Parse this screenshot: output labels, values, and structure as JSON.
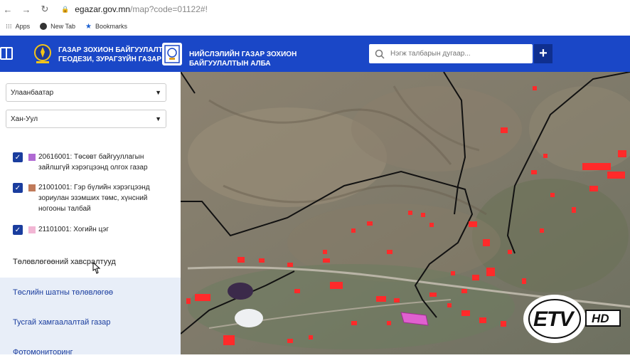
{
  "browser": {
    "back_icon": "←",
    "forward_icon": "→",
    "reload_icon": "↻",
    "url_host": "egazar.gov.mn",
    "url_path": "/map?code=01122#!",
    "bookmarks": [
      "Apps",
      "New Tab",
      "Bookmarks"
    ]
  },
  "header": {
    "org1_line1": "ГАЗАР ЗОХИОН БАЙГУУЛАЛТ,",
    "org1_line2": "ГЕОДЕЗИ, ЗУРАГЗҮЙН ГАЗАР",
    "org2_line1": "НИЙСЛЭЛИЙН ГАЗАР ЗОХИОН",
    "org2_line2": "БАЙГУУЛАЛТЫН АЛБА",
    "search_placeholder": "Нэгж талбарын дугаар...",
    "plus_label": "+"
  },
  "sidebar": {
    "city": "Улаанбаатар",
    "district": "Хан-Уул",
    "legend": [
      {
        "code_text": "20616001: Төсөвт байгууллагын зайлшгүй хэрэгцээнд олгох газар",
        "color": "#b06ad3"
      },
      {
        "code_text": "21001001: Гэр бүлийн хэрэгцээнд зориулан эзэмших төмс, хүнсний ногооны талбай",
        "color": "#c07a5a"
      },
      {
        "code_text": "21101001: Хогийн цэг",
        "color": "#f2b6d4"
      }
    ],
    "section_title": "Төлөвлөгөөний хавсралтууд",
    "nav": [
      "Төслийн шатны төлөвлөгөө",
      "Тусгай хамгаалалтай газар",
      "Фотомониторинг"
    ]
  },
  "map": {
    "parcel_color": "#ff2a2a",
    "boundary_color": "#111111"
  },
  "watermark": {
    "brand": "ETV",
    "hd": "HD"
  }
}
